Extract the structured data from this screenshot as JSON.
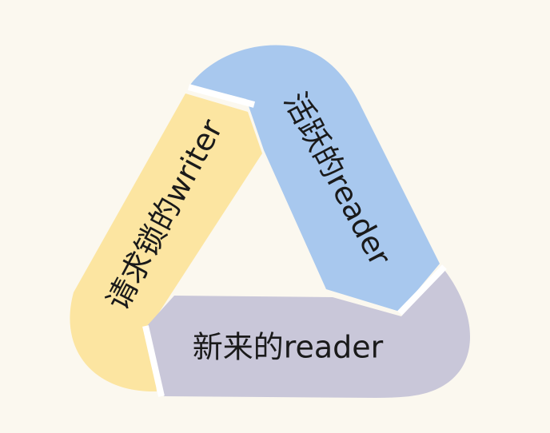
{
  "diagram": {
    "segments": [
      {
        "id": "requesting-writer",
        "label": "请求锁的writer",
        "color": "#FCE5A1"
      },
      {
        "id": "active-reader",
        "label": "活跃的reader",
        "color": "#A8C8EE"
      },
      {
        "id": "new-reader",
        "label": "新来的reader",
        "color": "#C9C7D9"
      }
    ],
    "colors": {
      "background": "#FBF8EF",
      "separator": "#FFFFFF",
      "text": "#1a1a1a"
    }
  }
}
